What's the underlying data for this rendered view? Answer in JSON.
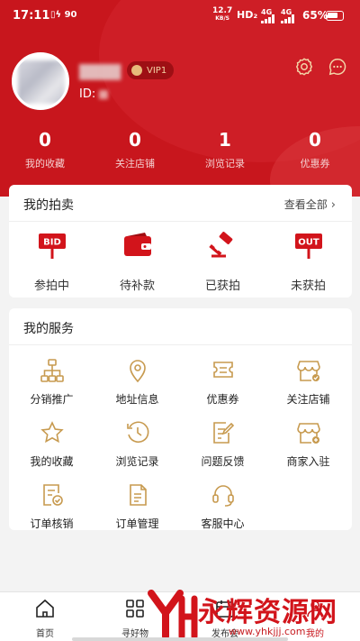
{
  "status_bar": {
    "time": "17:11",
    "left_icons": "▯ϟ 90",
    "net_speed_value": "12.7",
    "net_speed_unit": "KB/S",
    "hd": "HD₂",
    "signal1": "4G",
    "signal2": "4G",
    "battery": "65%"
  },
  "profile": {
    "name": "",
    "id_label": "ID:",
    "vip_label": "VIP1"
  },
  "stats": [
    {
      "value": "0",
      "label": "我的收藏"
    },
    {
      "value": "0",
      "label": "关注店铺"
    },
    {
      "value": "1",
      "label": "浏览记录"
    },
    {
      "value": "0",
      "label": "优惠券"
    }
  ],
  "auction": {
    "title": "我的拍卖",
    "view_all": "查看全部",
    "items": [
      {
        "label": "参拍中",
        "icon": "bid-sign-icon",
        "icon_text": "BID"
      },
      {
        "label": "待补款",
        "icon": "wallet-icon"
      },
      {
        "label": "已获拍",
        "icon": "gavel-check-icon"
      },
      {
        "label": "未获拍",
        "icon": "out-sign-icon",
        "icon_text": "OUT"
      }
    ]
  },
  "services": {
    "title": "我的服务",
    "items": [
      {
        "label": "分销推广",
        "icon": "org-chart-icon"
      },
      {
        "label": "地址信息",
        "icon": "location-pin-icon"
      },
      {
        "label": "优惠券",
        "icon": "coupon-icon"
      },
      {
        "label": "关注店铺",
        "icon": "store-follow-icon"
      },
      {
        "label": "我的收藏",
        "icon": "star-icon"
      },
      {
        "label": "浏览记录",
        "icon": "history-icon"
      },
      {
        "label": "问题反馈",
        "icon": "feedback-edit-icon"
      },
      {
        "label": "商家入驻",
        "icon": "store-add-icon"
      },
      {
        "label": "订单核销",
        "icon": "order-verify-icon"
      },
      {
        "label": "订单管理",
        "icon": "order-list-icon"
      },
      {
        "label": "客服中心",
        "icon": "headset-icon"
      }
    ]
  },
  "tabbar": {
    "tabs": [
      {
        "label": "首页",
        "icon": "home-icon"
      },
      {
        "label": "寻好物",
        "icon": "grid-icon"
      },
      {
        "label": "发布会",
        "icon": "calendar-icon"
      },
      {
        "label": "我的",
        "icon": "user-icon"
      }
    ]
  },
  "watermark": {
    "brand": "永辉资源网",
    "url": "www.yhkjjj.com"
  },
  "colors": {
    "primary_red": "#c8161d",
    "icon_gold": "#c79a4f",
    "icon_red": "#d2141b"
  }
}
